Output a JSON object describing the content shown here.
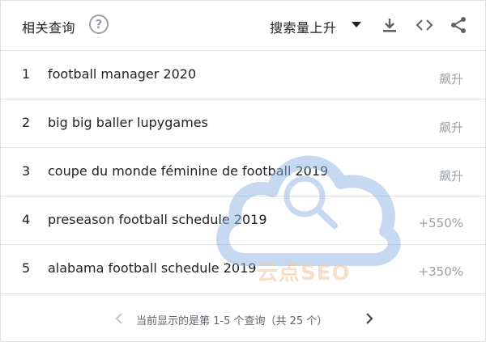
{
  "header": {
    "title": "相关查询",
    "help_glyph": "?",
    "sort_label": "搜索量上升"
  },
  "rows": [
    {
      "rank": "1",
      "query": "football manager 2020",
      "value": "飙升"
    },
    {
      "rank": "2",
      "query": "big big baller lupygames",
      "value": "飙升"
    },
    {
      "rank": "3",
      "query": "coupe du monde féminine de football 2019",
      "value": "飙升"
    },
    {
      "rank": "4",
      "query": "preseason football schedule 2019",
      "value": "+550%"
    },
    {
      "rank": "5",
      "query": "alabama football schedule 2019",
      "value": "+350%"
    }
  ],
  "footer": {
    "pager_text": "当前显示的是第 1-5 个查询（共 25 个）"
  },
  "watermark": {
    "text": "云点SEO"
  },
  "colors": {
    "text": "#202124",
    "muted": "#9aa0a6",
    "divider": "#e0e0e0",
    "watermark_blue": "#8fb4e3",
    "watermark_orange": "#f5c99f"
  },
  "icons": [
    "help-icon",
    "sort-dropdown-icon",
    "download-icon",
    "embed-code-icon",
    "share-icon",
    "chevron-left-icon",
    "chevron-right-icon",
    "cloud-search-watermark-icon"
  ]
}
